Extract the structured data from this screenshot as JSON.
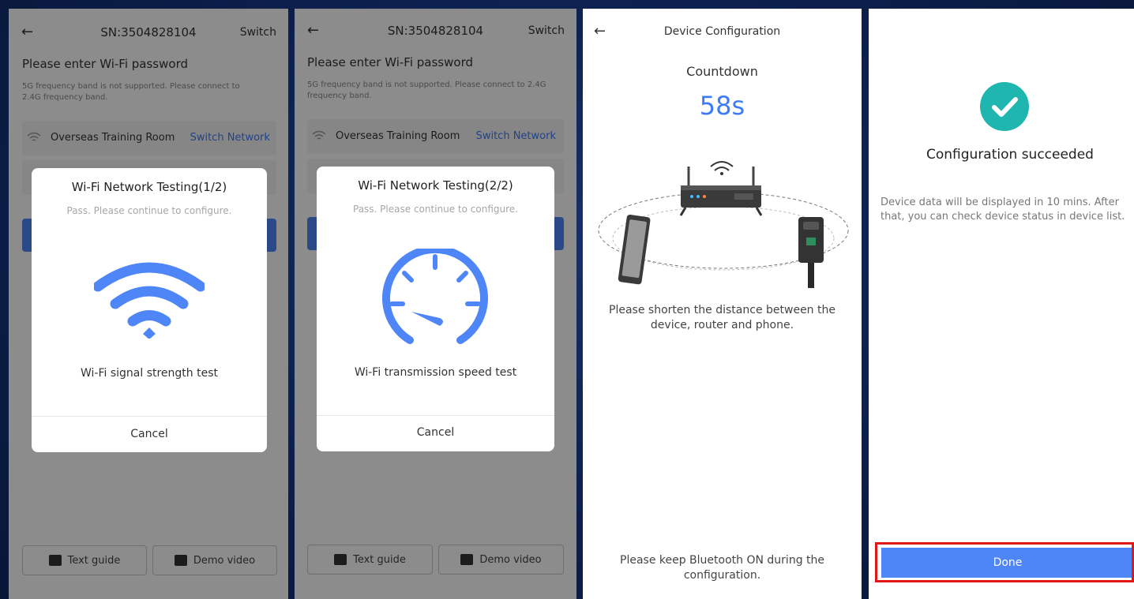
{
  "screens": [
    {
      "back_icon": "arrow-left-icon",
      "title": "SN:3504828104",
      "right_action": "Switch",
      "heading": "Please enter Wi-Fi password",
      "note": "5G frequency band is not supported. Please connect to 2.4G frequency band.",
      "network_name": "Overseas Training Room",
      "switch_network": "Switch Network",
      "text_guide": "Text guide",
      "demo_video": "Demo video",
      "modal": {
        "title": "Wi-Fi Network Testing(1/2)",
        "subtitle": "Pass. Please continue to configure.",
        "icon": "wifi-icon",
        "caption": "Wi-Fi signal strength test",
        "cancel": "Cancel"
      }
    },
    {
      "back_icon": "arrow-left-icon",
      "title": "SN:3504828104",
      "right_action": "Switch",
      "heading": "Please enter Wi-Fi password",
      "note": "5G frequency band is not supported. Please connect to 2.4G frequency band.",
      "network_name": "Overseas Training Room",
      "switch_network": "Switch Network",
      "text_guide": "Text guide",
      "demo_video": "Demo video",
      "modal": {
        "title": "Wi-Fi Network Testing(2/2)",
        "subtitle": "Pass. Please continue to configure.",
        "icon": "speedometer-icon",
        "caption": "Wi-Fi transmission speed test",
        "cancel": "Cancel"
      }
    },
    {
      "back_icon": "arrow-left-icon",
      "title": "Device Configuration",
      "countdown_label": "Countdown",
      "countdown_value": "58s",
      "illustration": "router-phone-device-illustration",
      "hint": "Please shorten the distance between the device, router and phone.",
      "bluetooth_note": "Please keep Bluetooth ON during the configuration."
    },
    {
      "success_icon": "check-circle-icon",
      "title": "Configuration succeeded",
      "message": "Device data will be displayed in 10 mins. After that, you can check device status in device list.",
      "done": "Done"
    }
  ],
  "colors": {
    "accent": "#3d7bf6",
    "button_blue": "#4f86f7",
    "success_teal": "#1fb6b0",
    "highlight_red": "#e01818",
    "backdrop": "#0c1f4c"
  }
}
